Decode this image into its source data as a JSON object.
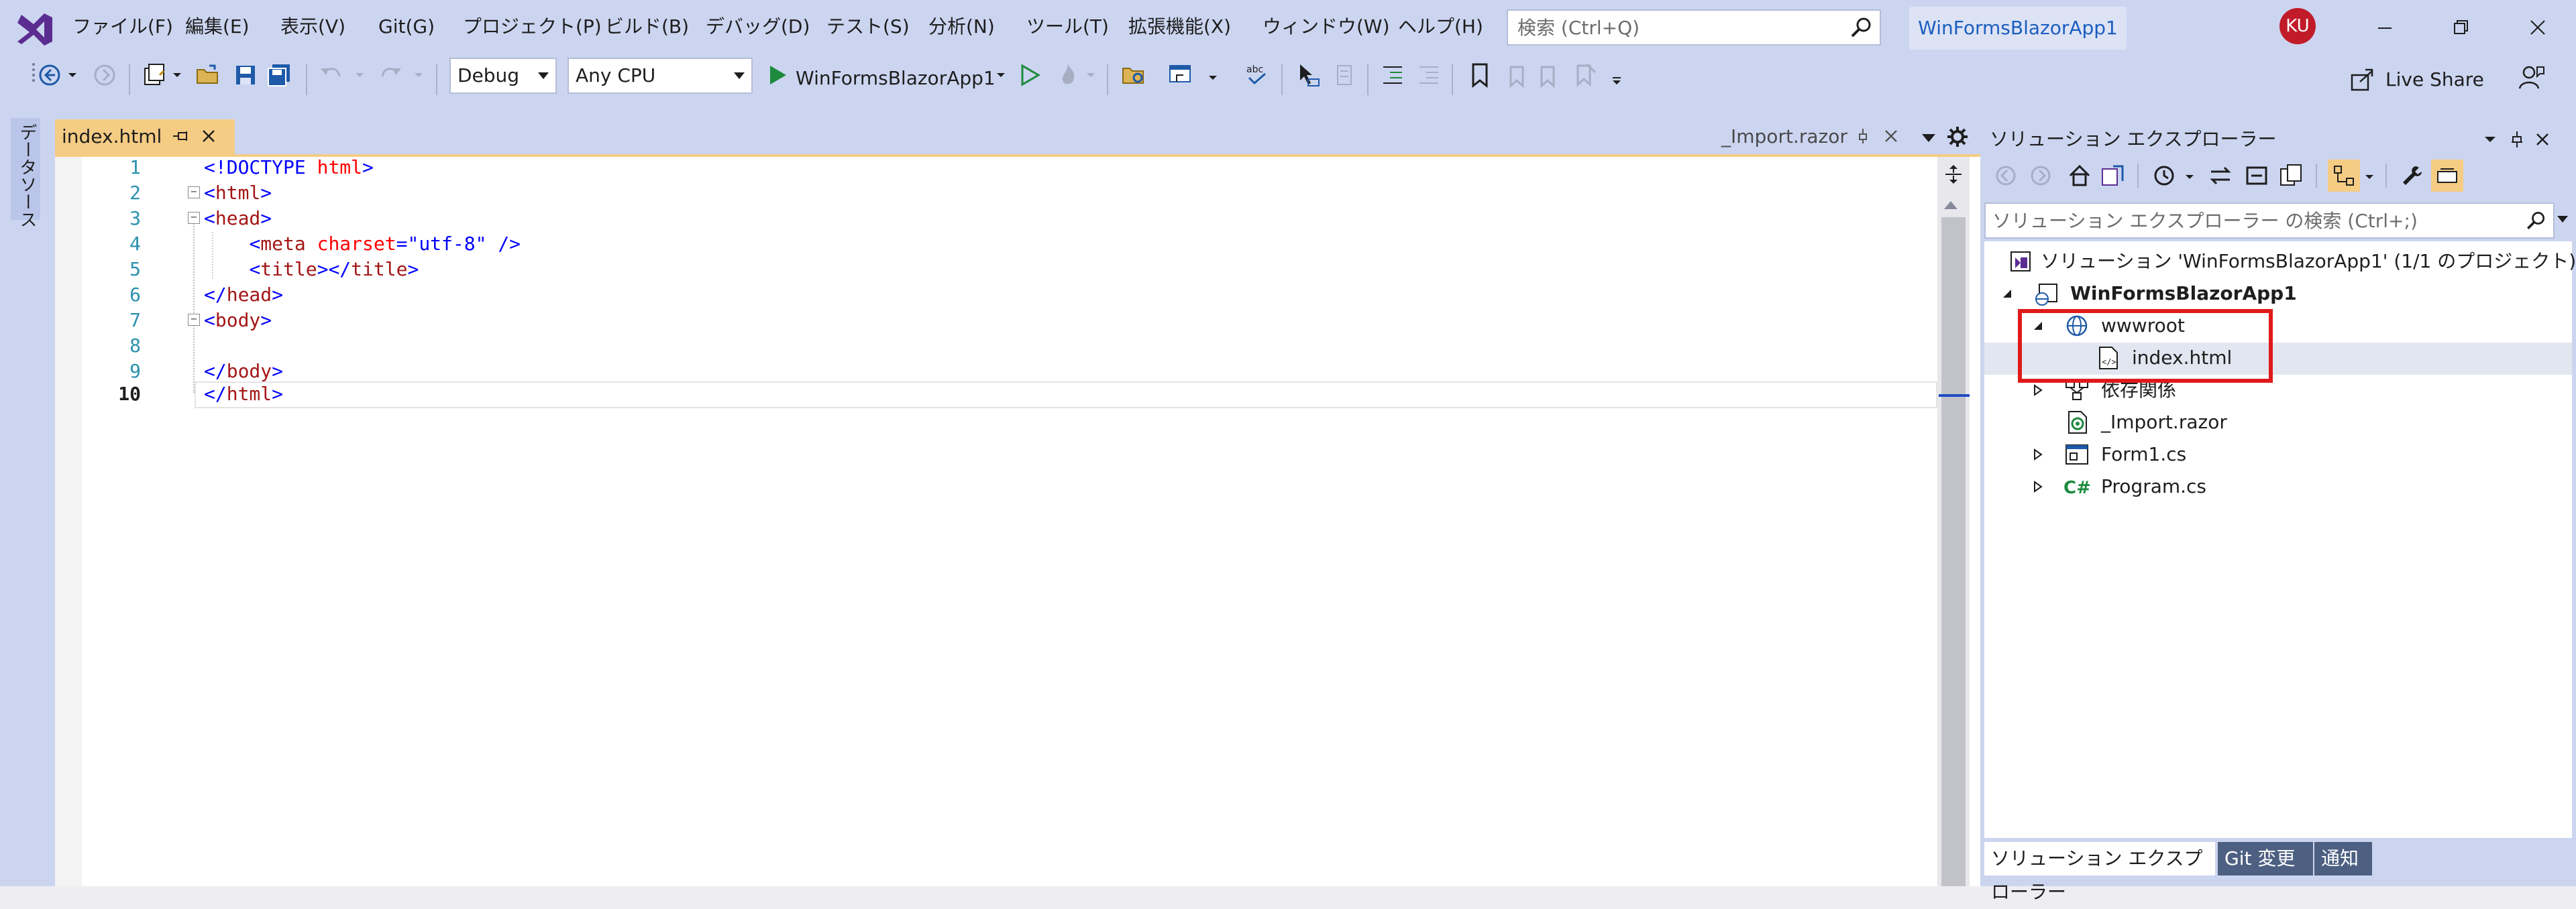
{
  "menu": {
    "items": [
      "ファイル(F)",
      "編集(E)",
      "表示(V)",
      "Git(G)",
      "プロジェクト(P)",
      "ビルド(B)",
      "デバッグ(D)",
      "テスト(S)",
      "分析(N)",
      "ツール(T)",
      "拡張機能(X)",
      "ウィンドウ(W)",
      "ヘルプ(H)"
    ],
    "search_placeholder": "検索 (Ctrl+Q)",
    "solution_name": "WinFormsBlazorApp1",
    "avatar_initials": "KU"
  },
  "toolbar": {
    "configuration": "Debug",
    "platform": "Any CPU",
    "run_target": "WinFormsBlazorApp1",
    "live_share": "Live Share"
  },
  "left_strip": {
    "data_sources": "データソース"
  },
  "editor": {
    "active_tab": "index.html",
    "preview_tab": "_Import.razor",
    "line_numbers": [
      "1",
      "2",
      "3",
      "4",
      "5",
      "6",
      "7",
      "8",
      "9",
      "10"
    ],
    "current_line": "10",
    "lines": [
      "<!DOCTYPE html>",
      "<html>",
      "<head>",
      "    <meta charset=\"utf-8\" />",
      "    <title></title>",
      "</head>",
      "<body>",
      "",
      "</body>",
      "</html>"
    ]
  },
  "solution_explorer": {
    "title": "ソリューション エクスプローラー",
    "search_placeholder": "ソリューション エクスプローラー の検索 (Ctrl+;)",
    "solution_node": "ソリューション 'WinFormsBlazorApp1' (1/1 のプロジェクト)",
    "project_node": "WinFormsBlazorApp1",
    "items": [
      {
        "label": "wwwroot",
        "icon": "globe-icon"
      },
      {
        "label": "index.html",
        "icon": "html-file-icon"
      },
      {
        "label": "依存関係",
        "icon": "dependencies-icon"
      },
      {
        "label": "_Import.razor",
        "icon": "razor-file-icon"
      },
      {
        "label": "Form1.cs",
        "icon": "form-icon"
      },
      {
        "label": "Program.cs",
        "icon": "csharp-icon"
      }
    ],
    "bottom_tabs": [
      "ソリューション エクスプローラー",
      "Git 変更",
      "通知"
    ]
  },
  "colors": {
    "chrome": "#CCD5F0",
    "active_tab": "#F5CC84",
    "highlight_border": "#E01A1A",
    "tag_blue": "#0000FF",
    "tag_name_red": "#A31515",
    "attr_red": "#FF0000",
    "line_number": "#2B91AF"
  }
}
